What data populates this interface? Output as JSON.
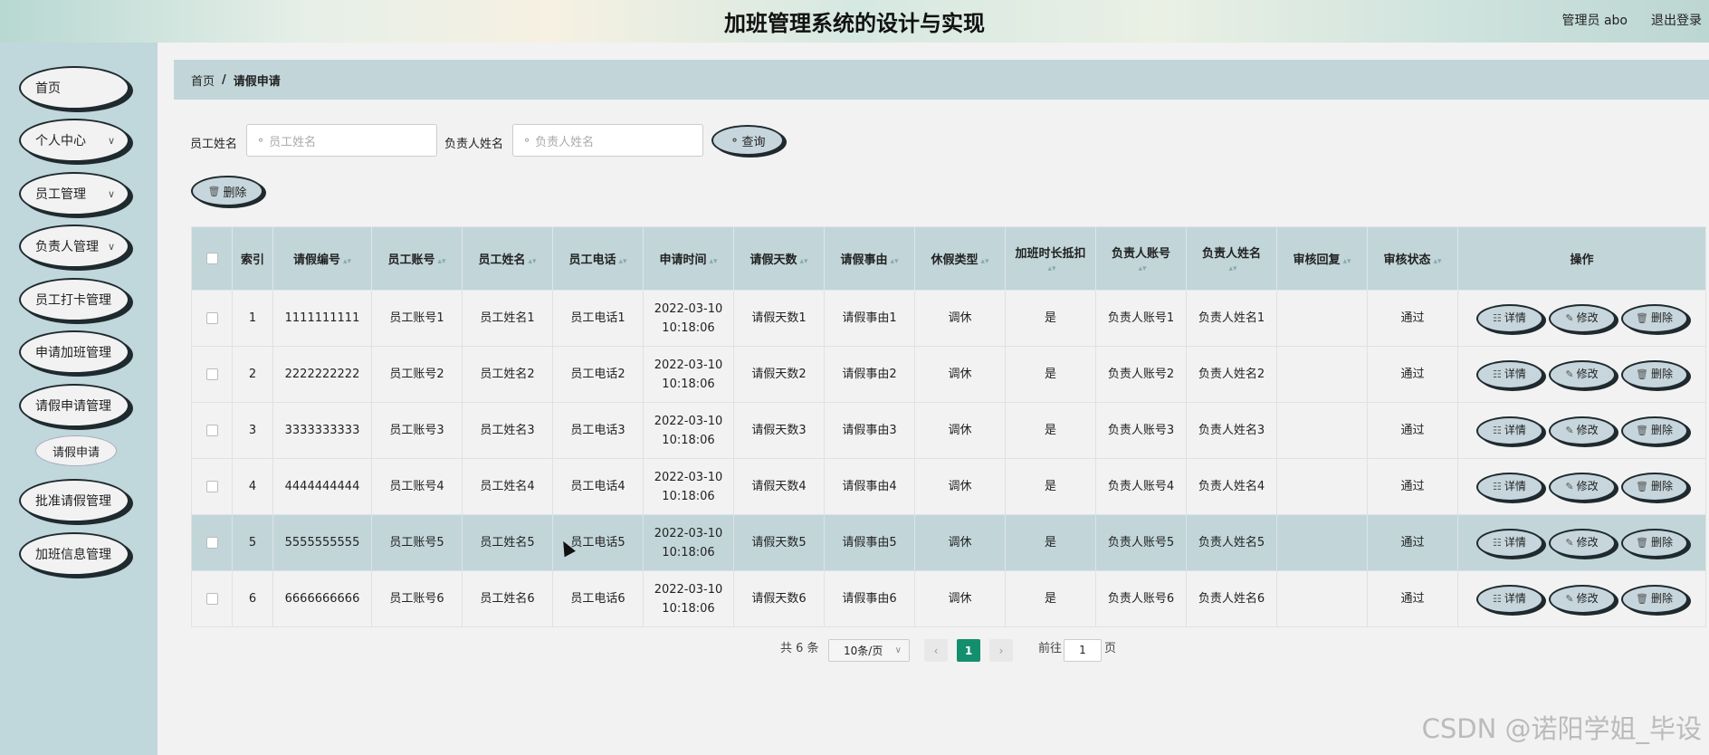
{
  "header": {
    "title": "加班管理系统的设计与实现",
    "user": "管理员 abo",
    "logout": "退出登录"
  },
  "sidebar": {
    "items": [
      {
        "label": "首页",
        "chev": false
      },
      {
        "label": "个人中心",
        "chev": true
      },
      {
        "label": "员工管理",
        "chev": true
      },
      {
        "label": "负责人管理",
        "chev": true
      },
      {
        "label": "员工打卡管理",
        "chev": false
      },
      {
        "label": "申请加班管理",
        "chev": false
      },
      {
        "label": "请假申请管理",
        "chev": false
      },
      {
        "label": "批准请假管理",
        "chev": false
      },
      {
        "label": "加班信息管理",
        "chev": false
      }
    ],
    "sub_item": "请假申请"
  },
  "breadcrumb": {
    "home": "首页",
    "sep": "/",
    "current": "请假申请"
  },
  "search": {
    "employee_label": "员工姓名",
    "employee_placeholder": "员工姓名",
    "manager_label": "负责人姓名",
    "manager_placeholder": "负责人姓名",
    "query_button": "查询"
  },
  "toolbar": {
    "delete_button": "删除"
  },
  "table": {
    "columns": [
      "",
      "索引",
      "请假编号",
      "员工账号",
      "员工姓名",
      "员工电话",
      "申请时间",
      "请假天数",
      "请假事由",
      "休假类型",
      "加班时长抵扣",
      "负责人账号",
      "负责人姓名",
      "审核回复",
      "审核状态",
      "操作"
    ],
    "rows": [
      {
        "idx": "1",
        "no": "1111111111",
        "acct": "员工账号1",
        "name": "员工姓名1",
        "phone": "员工电话1",
        "date": "2022-03-10",
        "time": "10:18:06",
        "days": "请假天数1",
        "reason": "请假事由1",
        "type": "调休",
        "deduct": "是",
        "macct": "负责人账号1",
        "mname": "负责人姓名1",
        "reply": "",
        "status": "通过"
      },
      {
        "idx": "2",
        "no": "2222222222",
        "acct": "员工账号2",
        "name": "员工姓名2",
        "phone": "员工电话2",
        "date": "2022-03-10",
        "time": "10:18:06",
        "days": "请假天数2",
        "reason": "请假事由2",
        "type": "调休",
        "deduct": "是",
        "macct": "负责人账号2",
        "mname": "负责人姓名2",
        "reply": "",
        "status": "通过"
      },
      {
        "idx": "3",
        "no": "3333333333",
        "acct": "员工账号3",
        "name": "员工姓名3",
        "phone": "员工电话3",
        "date": "2022-03-10",
        "time": "10:18:06",
        "days": "请假天数3",
        "reason": "请假事由3",
        "type": "调休",
        "deduct": "是",
        "macct": "负责人账号3",
        "mname": "负责人姓名3",
        "reply": "",
        "status": "通过"
      },
      {
        "idx": "4",
        "no": "4444444444",
        "acct": "员工账号4",
        "name": "员工姓名4",
        "phone": "员工电话4",
        "date": "2022-03-10",
        "time": "10:18:06",
        "days": "请假天数4",
        "reason": "请假事由4",
        "type": "调休",
        "deduct": "是",
        "macct": "负责人账号4",
        "mname": "负责人姓名4",
        "reply": "",
        "status": "通过"
      },
      {
        "idx": "5",
        "no": "5555555555",
        "acct": "员工账号5",
        "name": "员工姓名5",
        "phone": "员工电话5",
        "date": "2022-03-10",
        "time": "10:18:06",
        "days": "请假天数5",
        "reason": "请假事由5",
        "type": "调休",
        "deduct": "是",
        "macct": "负责人账号5",
        "mname": "负责人姓名5",
        "reply": "",
        "status": "通过"
      },
      {
        "idx": "6",
        "no": "6666666666",
        "acct": "员工账号6",
        "name": "员工姓名6",
        "phone": "员工电话6",
        "date": "2022-03-10",
        "time": "10:18:06",
        "days": "请假天数6",
        "reason": "请假事由6",
        "type": "调休",
        "deduct": "是",
        "macct": "负责人账号6",
        "mname": "负责人姓名6",
        "reply": "",
        "status": "通过"
      }
    ],
    "actions": {
      "detail": "详情",
      "edit": "修改",
      "delete": "删除"
    },
    "highlighted_row": 5
  },
  "pagination": {
    "total": "共 6 条",
    "page_size": "10条/页",
    "current_page": "1",
    "goto_label": "前往",
    "goto_value": "1",
    "page_suffix": "页"
  },
  "watermark": "CSDN @诺阳学姐_毕设",
  "colors": {
    "accent": "#138f6e",
    "panel": "#c2d6da"
  }
}
